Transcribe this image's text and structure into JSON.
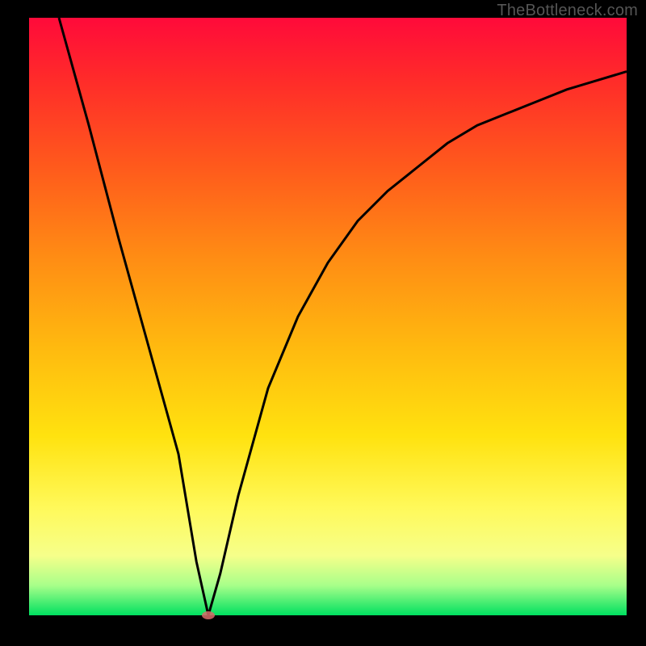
{
  "watermark": "TheBottleneck.com",
  "colors": {
    "frame": "#000000",
    "curve_stroke": "#000000",
    "marker_fill": "#d86a6a",
    "gradient_top": "#ff0a3a",
    "gradient_bottom": "#00e060"
  },
  "chart_data": {
    "type": "line",
    "title": "",
    "xlabel": "",
    "ylabel": "",
    "xlim": [
      0,
      100
    ],
    "ylim": [
      0,
      100
    ],
    "grid": false,
    "legend": false,
    "annotations": [],
    "series": [
      {
        "name": "curve",
        "x": [
          5,
          10,
          15,
          20,
          25,
          28,
          30,
          32,
          35,
          40,
          45,
          50,
          55,
          60,
          65,
          70,
          75,
          80,
          85,
          90,
          95,
          100
        ],
        "y": [
          100,
          82,
          63,
          45,
          27,
          9,
          0,
          7,
          20,
          38,
          50,
          59,
          66,
          71,
          75,
          79,
          82,
          84,
          86,
          88,
          89.5,
          91
        ]
      }
    ],
    "markers": [
      {
        "name": "min-point",
        "x": 30,
        "y": 0
      }
    ]
  }
}
